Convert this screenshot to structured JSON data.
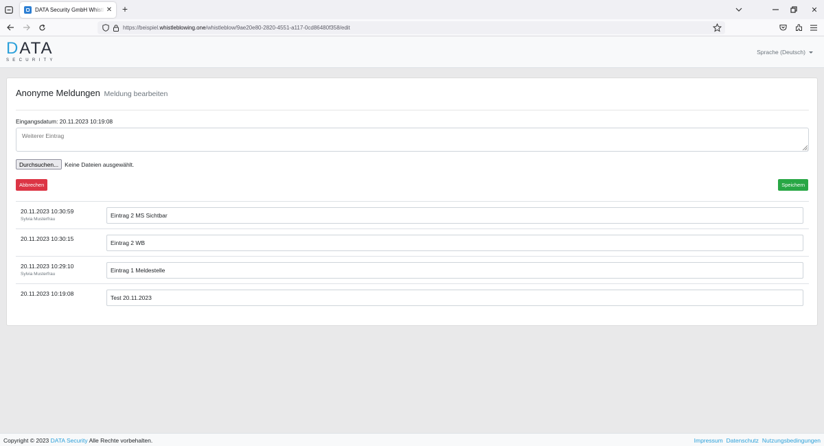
{
  "browser": {
    "tab_title": "DATA Security GmbH Whistleblowing",
    "url_prefix": "https://beispiel.",
    "url_host": "whistleblowing.one",
    "url_path": "/whistleblow/9ae20e80-2820-4551-a117-0cd86480f358/edit"
  },
  "header": {
    "logo_d": "D",
    "logo_rest": "ATA",
    "logo_sub": "SECURITY",
    "language": "Sprache (Deutsch)"
  },
  "form": {
    "title": "Anonyme Meldungen",
    "subtitle": "Meldung bearbeiten",
    "received_label": "Eingangsdatum: 20.11.2023 10:19:08",
    "textarea_placeholder": "Weiterer Eintrag",
    "file_button": "Durchsuchen...",
    "file_status": "Keine Dateien ausgewählt.",
    "cancel_label": "Abbrechen",
    "save_label": "Speichern"
  },
  "entries": [
    {
      "date": "20.11.2023 10:30:59",
      "author": "Sylvia Musterfrau",
      "text": "Eintrag 2 MS Sichtbar"
    },
    {
      "date": "20.11.2023 10:30:15",
      "author": "",
      "text": "Eintrag 2 WB"
    },
    {
      "date": "20.11.2023 10:29:10",
      "author": "Sylvia Musterfrau",
      "text": "Eintrag 1 Meldestelle"
    },
    {
      "date": "20.11.2023 10:19:08",
      "author": "",
      "text": "Test 20.11.2023"
    }
  ],
  "footer": {
    "copy_prefix": "Copyright © 2023",
    "copy_link": "DATA Security",
    "copy_suffix": "Alle Rechte vorbehalten.",
    "impressum": "Impressum",
    "datenschutz": "Datenschutz",
    "nutzung": "Nutzungsbedingungen"
  },
  "colors": {
    "accent": "#2ba0da",
    "danger": "#dc3545",
    "success": "#28a745"
  }
}
